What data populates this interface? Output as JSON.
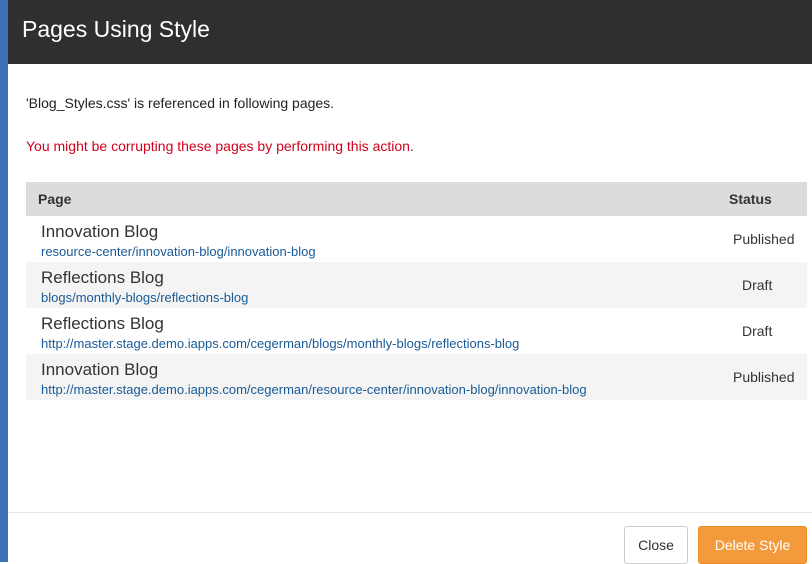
{
  "modal": {
    "title": "Pages Using Style",
    "intro": "'Blog_Styles.css' is referenced in following pages.",
    "warning": "You might be corrupting these pages by performing this action."
  },
  "table": {
    "headers": {
      "page": "Page",
      "status": "Status"
    },
    "rows": [
      {
        "title": "Innovation Blog",
        "link": "resource-center/innovation-blog/innovation-blog",
        "status": "Published"
      },
      {
        "title": "Reflections Blog",
        "link": "blogs/monthly-blogs/reflections-blog",
        "status": "Draft"
      },
      {
        "title": "Reflections Blog",
        "link": "http://master.stage.demo.iapps.com/cegerman/blogs/monthly-blogs/reflections-blog",
        "status": "Draft"
      },
      {
        "title": "Innovation Blog",
        "link": "http://master.stage.demo.iapps.com/cegerman/resource-center/innovation-blog/innovation-blog",
        "status": "Published"
      }
    ]
  },
  "footer": {
    "close_label": "Close",
    "delete_label": "Delete Style"
  },
  "colors": {
    "header_bg": "#2f2f2f",
    "warning": "#d0021b",
    "link": "#1a5a96",
    "delete_button": "#f39a3c"
  }
}
